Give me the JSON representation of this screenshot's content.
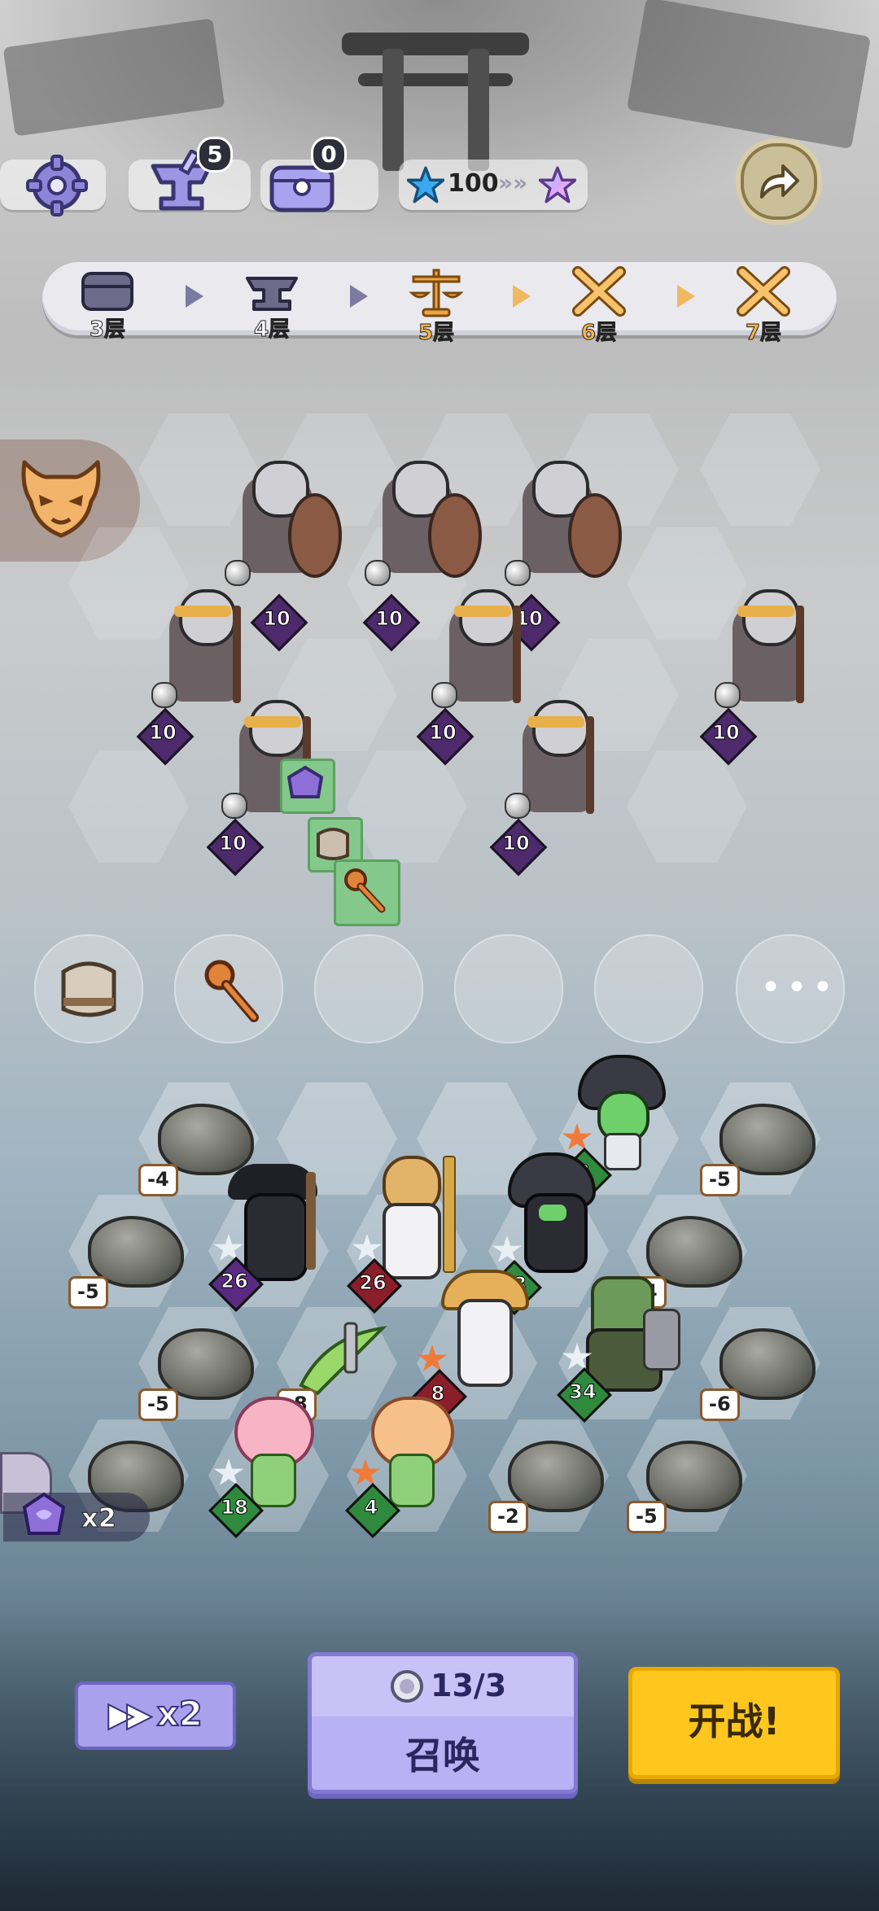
{
  "topbar": {
    "anvil_count": "5",
    "chest_count": "0",
    "star_currency": "100"
  },
  "floors": [
    {
      "label": "3层",
      "icon": "chest-icon",
      "state": "done"
    },
    {
      "label": "4层",
      "icon": "anvil-icon",
      "state": "done"
    },
    {
      "label": "5层",
      "icon": "scales-icon",
      "state": "current"
    },
    {
      "label": "6层",
      "icon": "crossed-swords-icon",
      "state": "upcoming"
    },
    {
      "label": "7层",
      "icon": "crossed-swords-icon",
      "state": "upcoming"
    }
  ],
  "enemies": [
    {
      "kind": "shield",
      "level": "10"
    },
    {
      "kind": "shield",
      "level": "10"
    },
    {
      "kind": "shield",
      "level": "10"
    },
    {
      "kind": "pick",
      "level": "10"
    },
    {
      "kind": "pick",
      "level": "10"
    },
    {
      "kind": "pick",
      "level": "10"
    },
    {
      "kind": "pick",
      "level": "10"
    },
    {
      "kind": "pick",
      "level": "10"
    }
  ],
  "item_slots": [
    {
      "icon": "armor-icon"
    },
    {
      "icon": "key-staff-icon"
    },
    {
      "icon": ""
    },
    {
      "icon": ""
    },
    {
      "icon": ""
    },
    {
      "icon": "more-dots-icon"
    }
  ],
  "rocks": [
    "-4",
    "-5",
    "-5",
    "-4",
    "-5",
    "-8",
    "-6",
    "-2",
    "-5",
    "-5"
  ],
  "heroes": [
    {
      "name": "mushroom-mage",
      "star": "orange",
      "level": "8",
      "rank": "green"
    },
    {
      "name": "dark-archer",
      "star": "white",
      "level": "26",
      "rank": "purple"
    },
    {
      "name": "blonde-priest",
      "star": "white",
      "level": "26",
      "rank": "red"
    },
    {
      "name": "dark-rogue",
      "star": "white",
      "level": "28",
      "rank": "green"
    },
    {
      "name": "straw-hat-monk",
      "star": "orange",
      "level": "8",
      "rank": "red"
    },
    {
      "name": "green-warrior",
      "star": "white",
      "level": "34",
      "rank": "green"
    },
    {
      "name": "pink-fairy",
      "star": "white",
      "level": "18",
      "rank": "green"
    },
    {
      "name": "pink-fairy-2",
      "star": "orange",
      "level": "4",
      "rank": "green"
    }
  ],
  "buff": {
    "multiplier": "x2"
  },
  "controls": {
    "speed_label": "x2",
    "summon_cost": "13/3",
    "summon_label": "召唤",
    "fight_label": "开战!"
  },
  "colors": {
    "accent_purple": "#b8b1f3",
    "fight_yellow": "#ffc71e",
    "floor_current": "#f0a640"
  }
}
